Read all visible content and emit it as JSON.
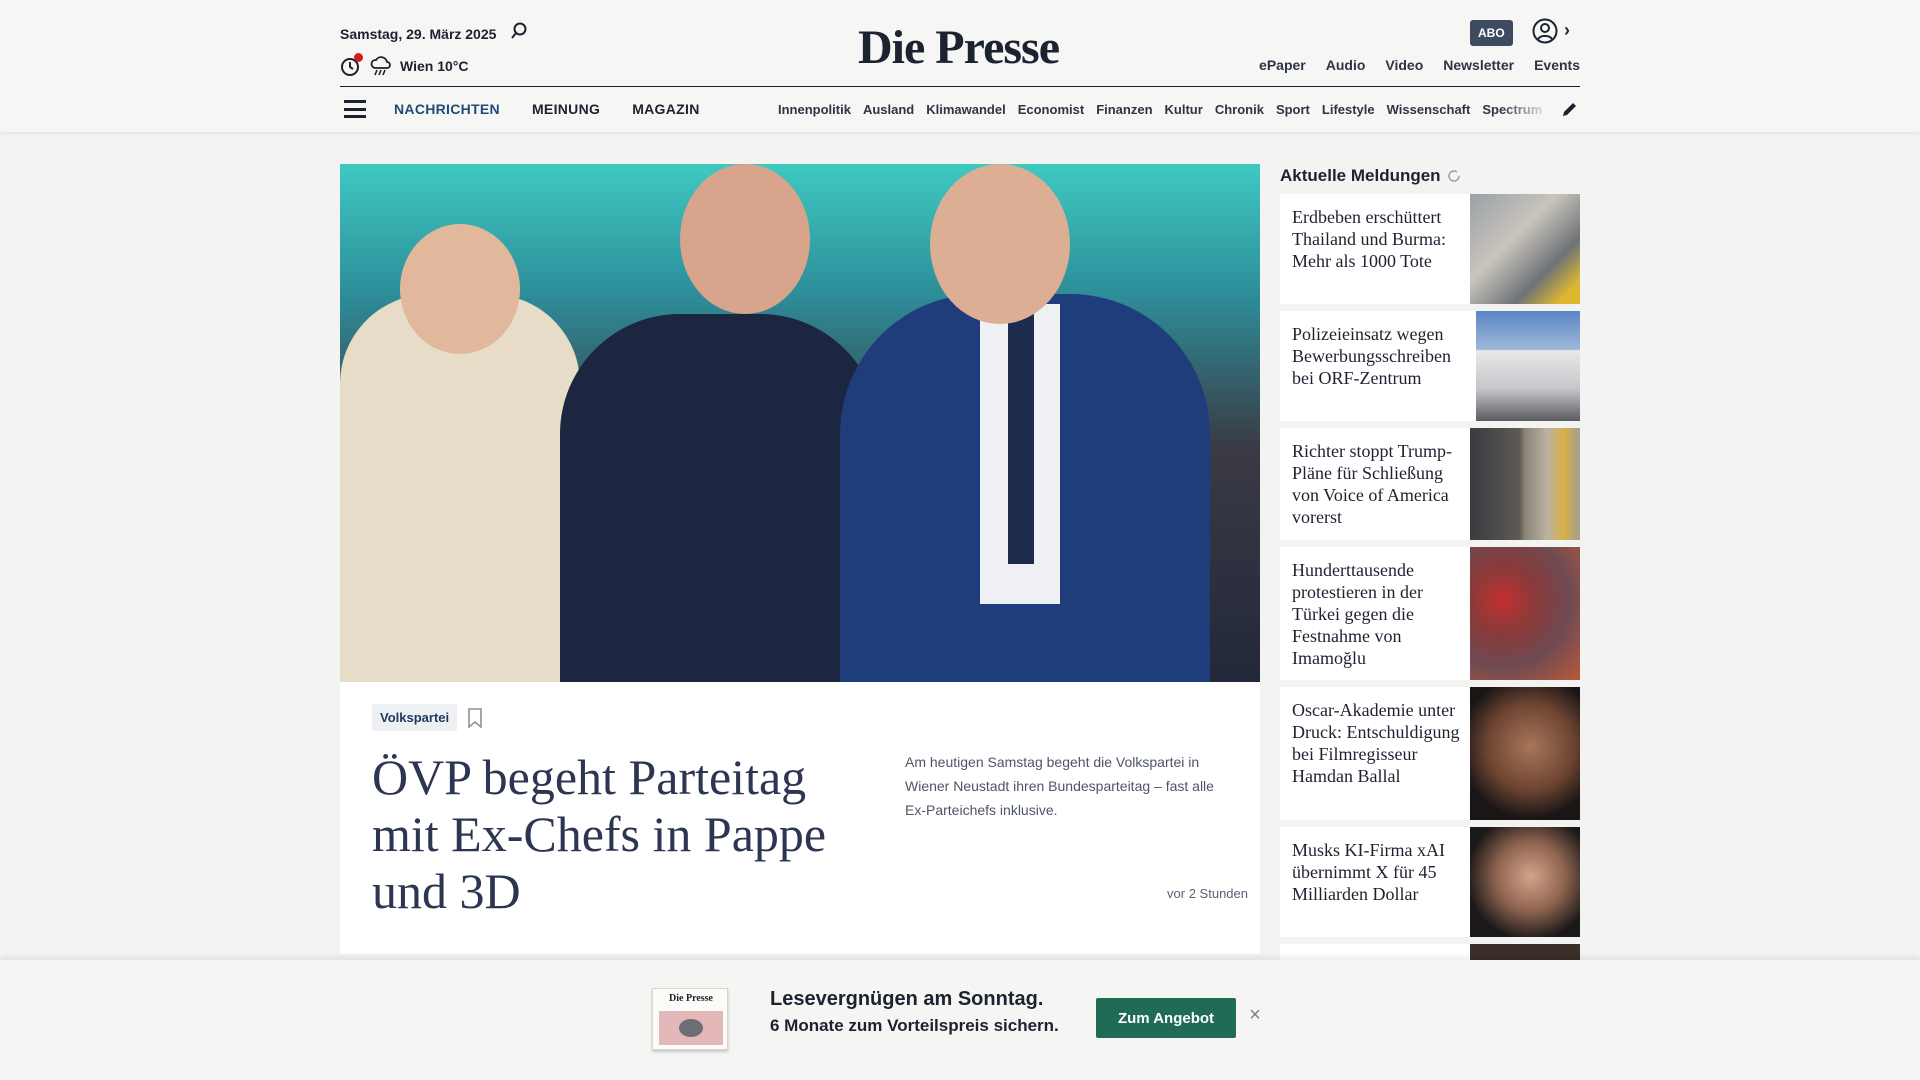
{
  "header": {
    "date": "Samstag, 29. März 2025",
    "weather": "Wien 10°C",
    "logo": "Die Presse",
    "abo": "ABO",
    "top_links": [
      "ePaper",
      "Audio",
      "Video",
      "Newsletter",
      "Events"
    ]
  },
  "nav": {
    "main": [
      "NACHRICHTEN",
      "MEINUNG",
      "MAGAZIN"
    ],
    "sub": [
      "Innenpolitik",
      "Ausland",
      "Klimawandel",
      "Economist",
      "Finanzen",
      "Kultur",
      "Chronik",
      "Sport",
      "Lifestyle",
      "Wissenschaft",
      "Spectrum"
    ]
  },
  "lead": {
    "tag": "Volkspartei",
    "title": "ÖVP begeht Parteitag mit Ex-Chefs in Pappe und 3D",
    "teaser": "Am heutigen Samstag begeht die Volkspartei in Wiener Neustadt ihren Bundesparteitag – fast alle Ex-Parteichefs inklusive.",
    "time": "vor 2 Stunden"
  },
  "sidebar": {
    "title": "Aktuelle Meldungen",
    "items": [
      {
        "title": "Erdbeben erschüttert Thailand und Burma: Mehr als 1000 Tote"
      },
      {
        "title": "Polizeieinsatz wegen Bewerbungsschreiben bei ORF-Zentrum"
      },
      {
        "title": "Richter stoppt Trump-Pläne für Schließung von Voice of America vorerst"
      },
      {
        "title": "Hunderttausende protestieren in der Türkei gegen die Festnahme von Imamoğlu"
      },
      {
        "title": "Oscar-Akademie unter Druck: Entschuldigung bei Filmregisseur Hamdan Ballal"
      },
      {
        "title": "Musks KI-Firma xAI übernimmt X für 45 Milliarden Dollar"
      }
    ]
  },
  "promo": {
    "paper_logo": "Die Presse",
    "headline": "Lesevergnügen am Sonntag.",
    "sub": "6 Monate zum Vorteilspreis sichern.",
    "button": "Zum Angebot",
    "close": "×"
  }
}
